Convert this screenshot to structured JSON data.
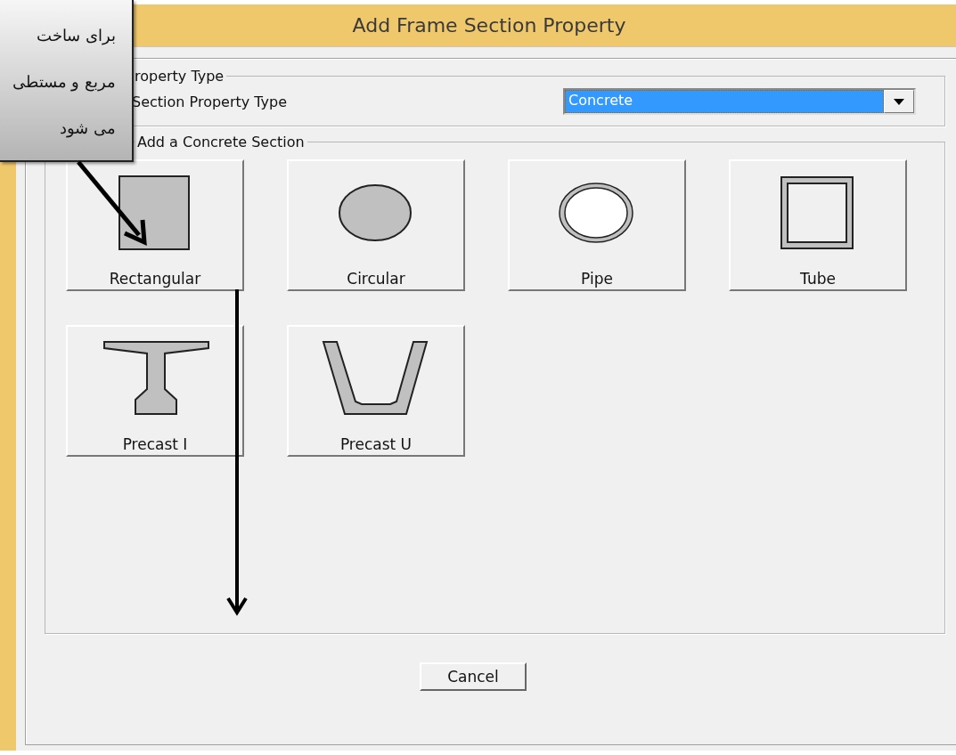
{
  "window": {
    "title": "Add Frame Section Property"
  },
  "property_type": {
    "legend": "roperty Type",
    "label": "Section Property Type",
    "dropdown": {
      "value": "Concrete",
      "highlighted": true
    }
  },
  "sections": {
    "legend": "Add a Concrete Section",
    "buttons": [
      {
        "label": "Rectangular",
        "kind": "rectangle"
      },
      {
        "label": "Circular",
        "kind": "circle"
      },
      {
        "label": "Pipe",
        "kind": "pipe"
      },
      {
        "label": "Tube",
        "kind": "tube"
      },
      {
        "label": "Precast I",
        "kind": "precast_i"
      },
      {
        "label": "Precast U",
        "kind": "precast_u"
      }
    ]
  },
  "cancel_button": "Cancel",
  "callout": {
    "lines": [
      "برای ساخت",
      "مربع و مستطی",
      "می شود"
    ]
  }
}
